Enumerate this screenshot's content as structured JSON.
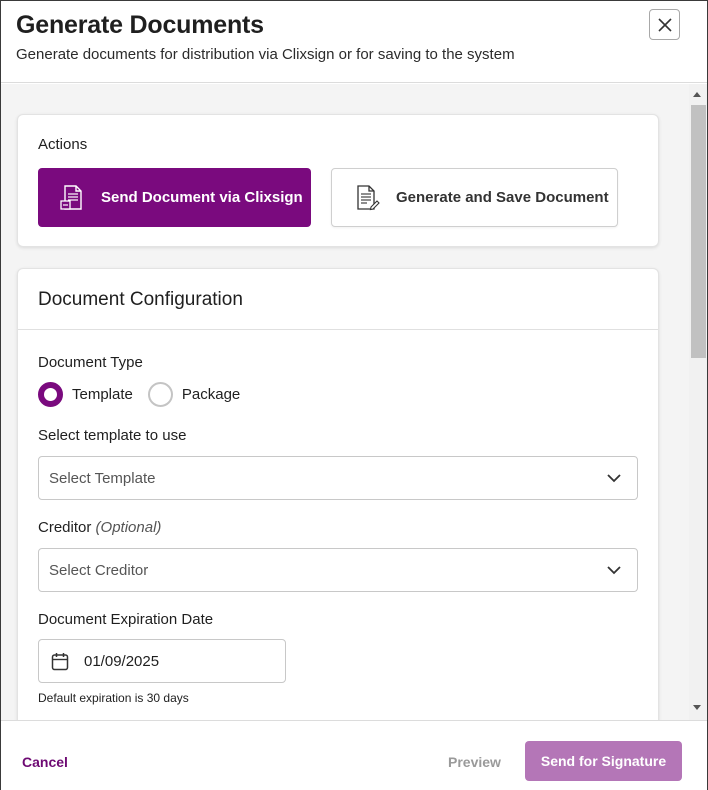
{
  "header": {
    "title": "Generate Documents",
    "subtitle": "Generate documents for distribution via Clixsign or for saving to the system",
    "close_icon": "close-icon"
  },
  "actions": {
    "label": "Actions",
    "send_clixsign_label": "Send Document via Clixsign",
    "generate_save_label": "Generate and Save Document",
    "accent_color": "#7a0a7e"
  },
  "config": {
    "title": "Document Configuration",
    "document_type": {
      "label": "Document Type",
      "options": [
        {
          "label": "Template",
          "checked": true
        },
        {
          "label": "Package",
          "checked": false
        }
      ]
    },
    "template": {
      "label": "Select template to use",
      "placeholder": "Select Template"
    },
    "creditor": {
      "label": "Creditor",
      "optional": "(Optional)",
      "placeholder": "Select Creditor"
    },
    "expiration": {
      "label": "Document Expiration Date",
      "value": "01/09/2025",
      "helper": "Default expiration is 30 days"
    }
  },
  "footer": {
    "cancel_label": "Cancel",
    "preview_label": "Preview",
    "send_label": "Send for Signature",
    "send_color": "#b476b7"
  }
}
